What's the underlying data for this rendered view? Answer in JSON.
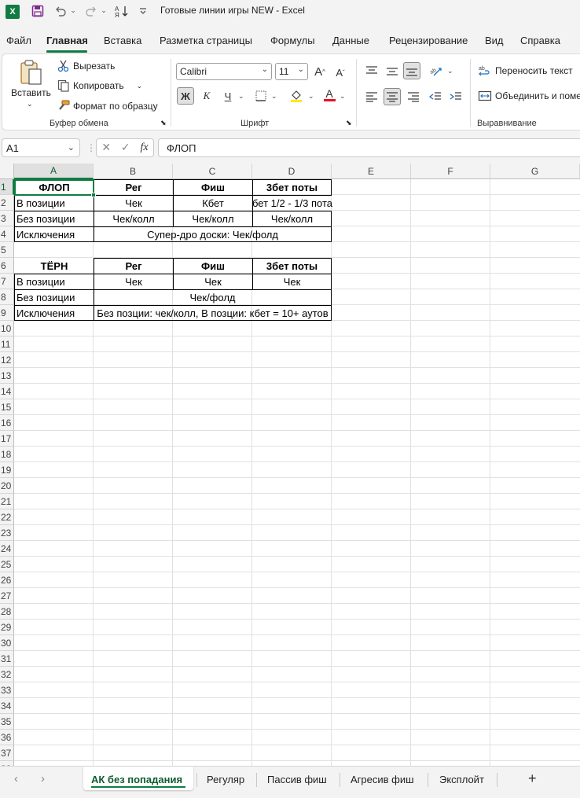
{
  "window": {
    "title": "Готовые линии игры NEW  -  Excel",
    "app_icon": "excel-logo",
    "accent": "#107c41"
  },
  "quick_access": {
    "save_icon": "save-icon",
    "undo_icon": "undo-icon",
    "redo_icon": "redo-icon",
    "sort_icon": "sort-icon",
    "customize_icon": "customize-icon"
  },
  "ribbon_tabs": [
    {
      "label": "Файл"
    },
    {
      "label": "Главная",
      "active": true
    },
    {
      "label": "Вставка"
    },
    {
      "label": "Разметка страницы"
    },
    {
      "label": "Формулы"
    },
    {
      "label": "Данные"
    },
    {
      "label": "Рецензирование"
    },
    {
      "label": "Вид"
    },
    {
      "label": "Справка"
    }
  ],
  "clipboard": {
    "paste_label": "Вставить",
    "cut_label": "Вырезать",
    "copy_label": "Копировать",
    "format_painter_label": "Формат по образцу",
    "group_label": "Буфер обмена"
  },
  "font": {
    "font_name": "Calibri",
    "font_size": "11",
    "grow_label": "A",
    "shrink_label": "A",
    "bold_label": "Ж",
    "italic_label": "К",
    "underline_label": "Ч",
    "font_color_label": "A",
    "group_label": "Шрифт"
  },
  "alignment": {
    "wrap_label": "Переносить текст",
    "merge_label": "Объединить и поме",
    "group_label": "Выравнивание"
  },
  "formula_bar": {
    "name_box": "A1",
    "fx_label": "fx",
    "cancel_glyph": "✕",
    "enter_glyph": "✓",
    "content": "ФЛОП"
  },
  "grid": {
    "columns": [
      "A",
      "B",
      "C",
      "D",
      "E",
      "F",
      "G"
    ],
    "selected_column": "A",
    "selected_row": 1,
    "row_numbers": [
      1,
      2,
      3,
      4,
      5,
      6,
      7,
      8,
      9,
      10,
      11,
      12,
      13,
      14,
      15,
      16,
      17,
      18,
      19,
      20,
      21,
      22,
      23,
      24,
      25,
      26,
      27,
      28,
      29,
      30,
      31,
      32,
      33,
      34,
      35,
      36,
      37,
      38
    ]
  },
  "cells": {
    "r1": {
      "a": "ФЛОП",
      "b": "Рег",
      "c": "Фиш",
      "d": "3бет поты"
    },
    "r2": {
      "a": "В позиции",
      "b": "Чек",
      "c": "Кбет",
      "d": "бет 1/2 - 1/3 пота"
    },
    "r3": {
      "a": "Без позиции",
      "b": "Чек/колл",
      "c": "Чек/колл",
      "d": "Чек/колл"
    },
    "r4": {
      "a": "Исключения",
      "bcd": "Супер-дро доски: Чек/фолд"
    },
    "r6": {
      "a": "ТЁРН",
      "b": "Рег",
      "c": "Фиш",
      "d": "3бет поты"
    },
    "r7": {
      "a": "В позиции",
      "b": "Чек",
      "c": "Чек",
      "d": "Чек"
    },
    "r8": {
      "a": "Без позиции",
      "bcd": "Чек/фолд"
    },
    "r9": {
      "a": "Исключения",
      "bcd": "Без позции: чек/колл, В позции: кбет = 10+ аутов"
    }
  },
  "sheet_tabs": [
    {
      "label": "АК без попадания",
      "active": true
    },
    {
      "label": "Регуляр"
    },
    {
      "label": "Пассив фиш"
    },
    {
      "label": "Агресив фиш"
    },
    {
      "label": "Эксплойт"
    }
  ],
  "sheet_nav": {
    "prev": "‹",
    "next": "›",
    "add": "+"
  }
}
